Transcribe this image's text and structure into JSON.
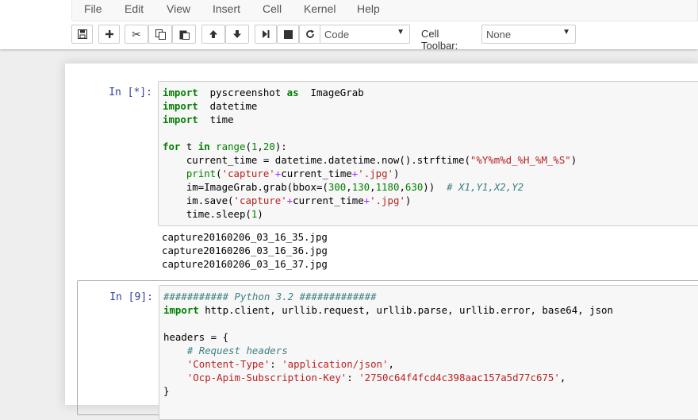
{
  "menu": [
    "File",
    "Edit",
    "View",
    "Insert",
    "Cell",
    "Kernel",
    "Help"
  ],
  "toolbar": {
    "cell_type_value": "Code",
    "cell_toolbar_label": "Cell Toolbar:",
    "cell_toolbar_value": "None",
    "icons": [
      "save-icon",
      "plus-icon",
      "cut-icon",
      "copy-icon",
      "paste-icon",
      "arrow-up-icon",
      "arrow-down-icon",
      "step-forward-icon",
      "stop-icon",
      "restart-icon"
    ]
  },
  "cells": [
    {
      "prompt": "In [*]:",
      "lines": [
        [
          [
            "kw",
            "import"
          ],
          [
            "",
            "  pyscreenshot "
          ],
          [
            "kw",
            "as"
          ],
          [
            "",
            "  ImageGrab"
          ]
        ],
        [
          [
            "kw",
            "import"
          ],
          [
            "",
            "  datetime"
          ]
        ],
        [
          [
            "kw",
            "import"
          ],
          [
            "",
            "  time"
          ]
        ],
        [],
        [
          [
            "kw",
            "for"
          ],
          [
            "",
            " t "
          ],
          [
            "kw",
            "in"
          ],
          [
            "",
            " "
          ],
          [
            "bi",
            "range"
          ],
          [
            "",
            "("
          ],
          [
            "nu",
            "1"
          ],
          [
            "",
            ","
          ],
          [
            "nu",
            "20"
          ],
          [
            "",
            "):"
          ]
        ],
        [
          [
            "",
            "    current_time = datetime.datetime.now().strftime("
          ],
          [
            "st",
            "\"%Y%m%d_%H_%M_%S\""
          ],
          [
            "",
            ")"
          ]
        ],
        [
          [
            "",
            "    "
          ],
          [
            "bi",
            "print"
          ],
          [
            "",
            "("
          ],
          [
            "st",
            "'capture'"
          ],
          [
            "op",
            "+"
          ],
          [
            "",
            "current_time"
          ],
          [
            "op",
            "+"
          ],
          [
            "st",
            "'.jpg'"
          ],
          [
            "",
            ")"
          ]
        ],
        [
          [
            "",
            "    im=ImageGrab.grab(bbox=("
          ],
          [
            "nu",
            "300"
          ],
          [
            "",
            ","
          ],
          [
            "nu",
            "130"
          ],
          [
            "",
            ","
          ],
          [
            "nu",
            "1180"
          ],
          [
            "",
            ","
          ],
          [
            "nu",
            "630"
          ],
          [
            "",
            "))  "
          ],
          [
            "cm",
            "# X1,Y1,X2,Y2"
          ]
        ],
        [
          [
            "",
            "    im.save("
          ],
          [
            "st",
            "'capture'"
          ],
          [
            "op",
            "+"
          ],
          [
            "",
            "current_time"
          ],
          [
            "op",
            "+"
          ],
          [
            "st",
            "'.jpg'"
          ],
          [
            "",
            ")"
          ]
        ],
        [
          [
            "",
            "    time.sleep("
          ],
          [
            "nu",
            "1"
          ],
          [
            "",
            ")"
          ]
        ]
      ],
      "output": [
        "capture20160206_03_16_35.jpg",
        "capture20160206_03_16_36.jpg",
        "capture20160206_03_16_37.jpg"
      ]
    },
    {
      "prompt": "In [9]:",
      "lines": [
        [
          [
            "cm",
            "########### Python 3.2 #############"
          ]
        ],
        [
          [
            "kw",
            "import"
          ],
          [
            "",
            " http.client, urllib.request, urllib.parse, urllib.error, base64, json"
          ]
        ],
        [],
        [
          [
            "",
            "headers = {"
          ]
        ],
        [
          [
            "",
            "    "
          ],
          [
            "cm",
            "# Request headers"
          ]
        ],
        [
          [
            "",
            "    "
          ],
          [
            "st",
            "'Content-Type'"
          ],
          [
            "",
            ": "
          ],
          [
            "st",
            "'application/json'"
          ],
          [
            "",
            ","
          ]
        ],
        [
          [
            "",
            "    "
          ],
          [
            "st",
            "'Ocp-Apim-Subscription-Key'"
          ],
          [
            "",
            ": "
          ],
          [
            "st",
            "'2750c64f4fcd4c398aac157a5d77c675'"
          ],
          [
            "",
            ","
          ]
        ],
        [
          [
            "",
            "}"
          ]
        ]
      ]
    }
  ]
}
